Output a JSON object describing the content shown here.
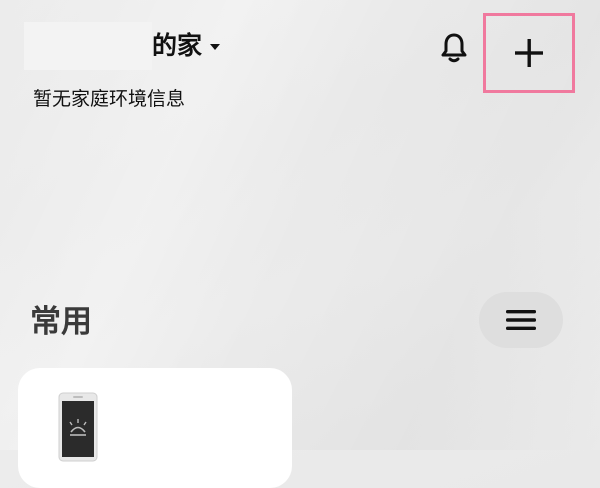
{
  "header": {
    "home_name": "的家",
    "env_info": "暂无家庭环境信息"
  },
  "sections": {
    "common": {
      "title": "常用"
    }
  },
  "icons": {
    "bell": "bell-icon",
    "add": "plus-icon",
    "menu": "hamburger-icon",
    "device": "phone-device-icon"
  },
  "colors": {
    "highlight_border": "#f0799e",
    "menu_pill": "#dedede",
    "card": "#ffffff"
  }
}
